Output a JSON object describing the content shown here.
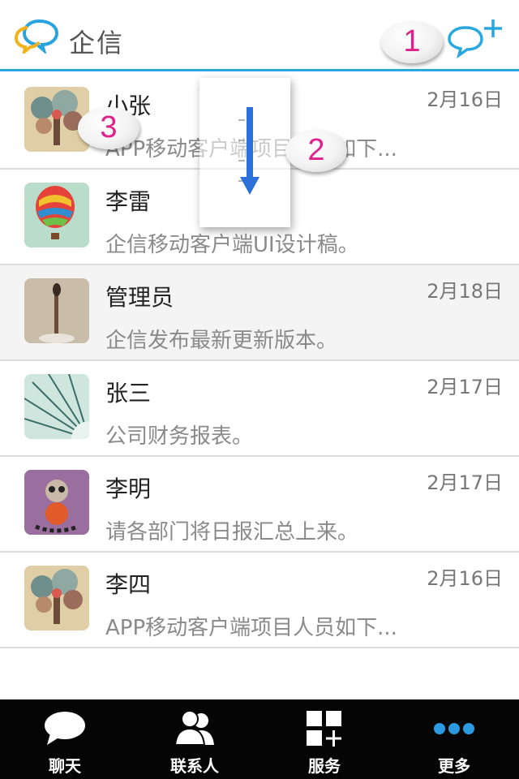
{
  "header": {
    "title": "企信",
    "logo_icon": "chat-bubbles-logo-icon",
    "add_icon": "add-chat-icon"
  },
  "conversations": [
    {
      "name": "小张",
      "date": "2月16日",
      "preview": "APP移动客户端项目人员如下...",
      "avatar": "tree-art"
    },
    {
      "name": "李雷",
      "date": "",
      "preview": "企信移动客户端UI设计稿。",
      "avatar": "hot-air-balloon"
    },
    {
      "name": "管理员",
      "date": "2月18日",
      "preview": "企信发布最新更新版本。",
      "avatar": "burning-match"
    },
    {
      "name": "张三",
      "date": "2月17日",
      "preview": "公司财务报表。",
      "avatar": "dandelion"
    },
    {
      "name": "李明",
      "date": "2月17日",
      "preview": "请各部门将日报汇总上来。",
      "avatar": "lemur-cartoon"
    },
    {
      "name": "李四",
      "date": "2月16日",
      "preview": "APP移动客户端项目人员如下...",
      "avatar": "tree-art"
    }
  ],
  "nav": [
    {
      "label": "聊天",
      "icon": "chat-bubble-icon"
    },
    {
      "label": "联系人",
      "icon": "contacts-icon"
    },
    {
      "label": "服务",
      "icon": "services-grid-icon"
    },
    {
      "label": "更多",
      "icon": "more-dots-icon"
    }
  ],
  "tutorial_markers": [
    "1",
    "2",
    "3"
  ],
  "colors": {
    "accent": "#29a8e0",
    "marker_text": "#e0208a",
    "nav_bg": "#050505"
  }
}
